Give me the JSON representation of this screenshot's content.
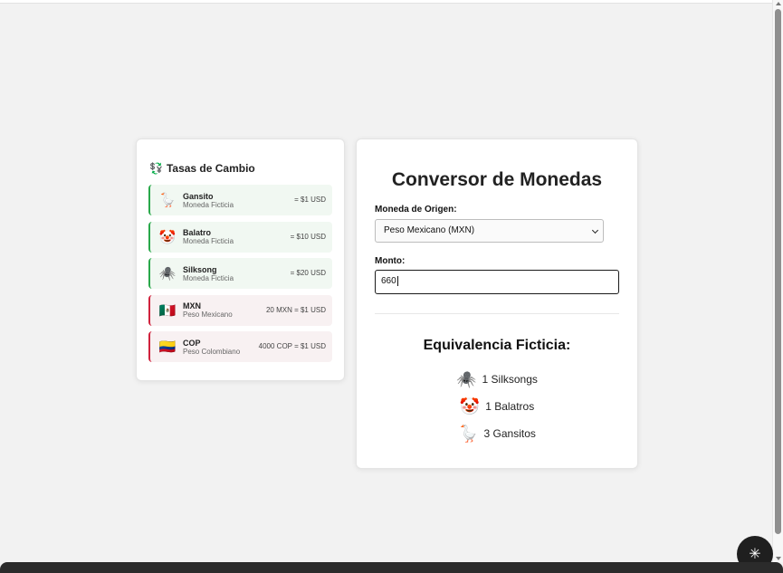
{
  "rates_panel": {
    "icon": "💱",
    "title": "Tasas de Cambio",
    "items": [
      {
        "icon": "🪿",
        "name": "Gansito",
        "sub": "Moneda Ficticia",
        "value": "= $1 USD",
        "kind": "fict"
      },
      {
        "icon": "🤡",
        "name": "Balatro",
        "sub": "Moneda Ficticia",
        "value": "= $10 USD",
        "kind": "fict"
      },
      {
        "icon": "🕷️",
        "name": "Silksong",
        "sub": "Moneda Ficticia",
        "value": "= $20 USD",
        "kind": "fict"
      },
      {
        "icon": "🇲🇽",
        "name": "MXN",
        "sub": "Peso Mexicano",
        "value": "20 MXN = $1 USD",
        "kind": "real"
      },
      {
        "icon": "🇨🇴",
        "name": "COP",
        "sub": "Peso Colombiano",
        "value": "4000 COP = $1 USD",
        "kind": "real"
      }
    ]
  },
  "converter": {
    "title": "Conversor de Monedas",
    "origin_label": "Moneda de Origen:",
    "origin_value": "Peso Mexicano (MXN)",
    "amount_label": "Monto:",
    "amount_value": "660",
    "equivalence_title": "Equivalencia Ficticia:",
    "results": [
      {
        "icon": "🕷️",
        "text": "1 Silksongs"
      },
      {
        "icon": "🤡",
        "text": "1 Balatros"
      },
      {
        "icon": "🪿",
        "text": "3 Gansitos"
      }
    ]
  },
  "colors": {
    "fictitious_accent": "#29a84a",
    "real_accent": "#d0223d",
    "background": "#f2f2f2"
  },
  "fab": {
    "icon": "loading-spinner-icon"
  }
}
